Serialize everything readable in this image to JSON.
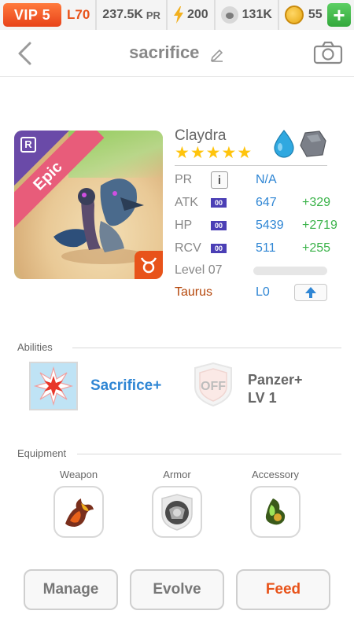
{
  "topbar": {
    "vip": "VIP 5",
    "level": "L70",
    "power": "237.5K",
    "power_unit": "PR",
    "energy": "200",
    "food": "131K",
    "coins": "55",
    "add": "+"
  },
  "header": {
    "title": "sacrifice"
  },
  "monster": {
    "name": "Claydra",
    "rarity": "Epic",
    "rank_badge": "R",
    "stars": 5,
    "elements": [
      "water",
      "earth"
    ],
    "stats": {
      "pr_label": "PR",
      "pr_info": "i",
      "pr_value": "N/A",
      "atk_label": "ATK",
      "atk_tag": "00",
      "atk_value": "647",
      "atk_bonus": "+329",
      "hp_label": "HP",
      "hp_tag": "00",
      "hp_value": "5439",
      "hp_bonus": "+2719",
      "rcv_label": "RCV",
      "rcv_tag": "00",
      "rcv_value": "511",
      "rcv_bonus": "+255"
    },
    "level_label": "Level 07",
    "level_progress": 0.0,
    "zodiac_label": "Taurus",
    "zodiac_level": "L0"
  },
  "abilities": {
    "title": "Abilities",
    "items": [
      {
        "label": "Sacrifice+",
        "icon": "sacrifice-burst-icon"
      },
      {
        "label_line1": "Panzer+",
        "label_line2": "LV 1",
        "icon_text": "OFF",
        "icon": "panzer-off-icon"
      }
    ]
  },
  "equipment": {
    "title": "Equipment",
    "slots": [
      {
        "label": "Weapon",
        "icon": "weapon-icon"
      },
      {
        "label": "Armor",
        "icon": "armor-icon"
      },
      {
        "label": "Accessory",
        "icon": "accessory-icon"
      }
    ]
  },
  "buttons": {
    "manage": "Manage",
    "evolve": "Evolve",
    "feed": "Feed"
  },
  "colors": {
    "accent_orange": "#e8531a",
    "stat_blue": "#2f86d4",
    "bonus_green": "#3bb34a",
    "epic_pink": "#e85c7a",
    "rank_purple": "#6a4aa8"
  }
}
